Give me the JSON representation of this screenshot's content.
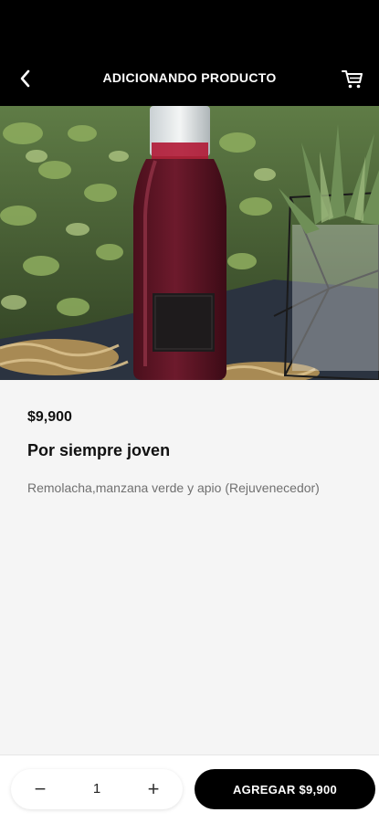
{
  "header": {
    "title": "ADICIONANDO PRODUCTO",
    "back_icon": "chevron-left-icon",
    "cart_icon": "shopping-cart-icon",
    "background": "#000000"
  },
  "product": {
    "price": "$9,900",
    "name": "Por siempre joven",
    "description": "Remolacha,manzana verde y apio (Rejuvenecedor)",
    "image": "product-photo"
  },
  "footer": {
    "minus_label": "−",
    "quantity": "1",
    "plus_label": "+",
    "add_button_label": "AGREGAR $9,900",
    "accent": "#000000"
  }
}
